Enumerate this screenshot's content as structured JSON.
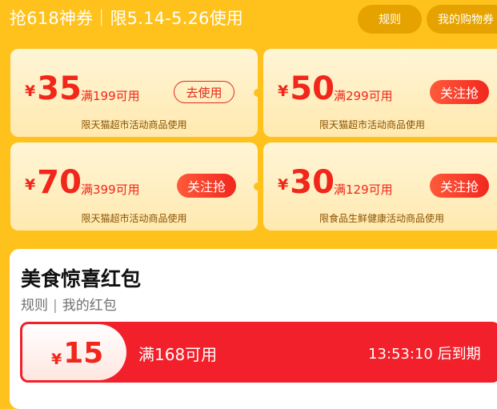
{
  "header": {
    "title": "抢618神券｜限5.14-5.26使用",
    "rules_label": "规则",
    "cart_label": "我的购物券"
  },
  "coupons": [
    {
      "currency": "¥",
      "amount": "35",
      "condition": "满199可用",
      "action": "去使用",
      "scope": "限天猫超市活动商品使用"
    },
    {
      "currency": "¥",
      "amount": "50",
      "condition": "满299可用",
      "action": "关注抢",
      "scope": "限天猫超市活动商品使用"
    },
    {
      "currency": "¥",
      "amount": "70",
      "condition": "满399可用",
      "action": "关注抢",
      "scope": "限天猫超市活动商品使用"
    },
    {
      "currency": "¥",
      "amount": "30",
      "condition": "满129可用",
      "action": "关注抢",
      "scope": "限食品生鲜健康活动商品使用"
    }
  ],
  "food_section": {
    "title": "美食惊喜红包",
    "rules_link": "规则",
    "separator": "|",
    "my_redpack_link": "我的红包",
    "redpack": {
      "currency": "¥",
      "amount": "15",
      "condition": "满168可用",
      "countdown": "13:53:10 后到期"
    }
  },
  "colors": {
    "background": "#ffc21c",
    "accent_red": "#f0271a",
    "pill": "#e6a300"
  }
}
